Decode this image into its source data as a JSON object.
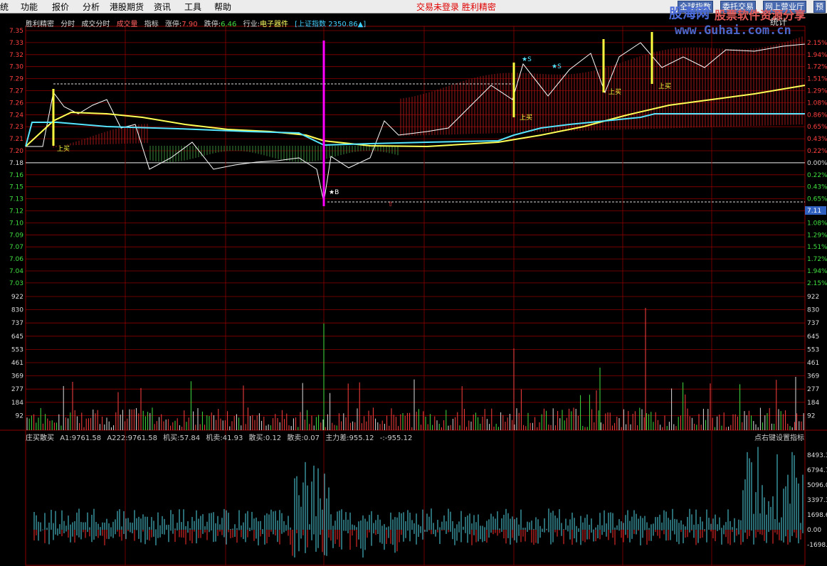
{
  "menu": [
    "统",
    "功能",
    "报价",
    "分析",
    "港股期货",
    "资讯",
    "工具",
    "帮助"
  ],
  "notice": "交易未登录  胜利精密",
  "top_buttons": [
    "全球指数",
    "委托交易",
    "网上营业厅",
    "预"
  ],
  "watermark": {
    "brand": "股海网",
    "slogan": "股票软件资源分享",
    "url": "www.Guhai.com.cn"
  },
  "stat_label": "统计",
  "header": {
    "stock_name": "胜利精密",
    "items": [
      "分时",
      "成交分时",
      "成交量",
      "指标"
    ],
    "limit_up_label": "涨停:",
    "limit_up": "7.90",
    "limit_down_label": "跌停:",
    "limit_down": "6.46",
    "industry_label": "行业:",
    "industry": "电子器件",
    "index_text": "[上证指数 2350.86▲]"
  },
  "price_axis_left": [
    "7.35",
    "7.33",
    "7.32",
    "7.30",
    "7.29",
    "7.27",
    "7.26",
    "7.24",
    "7.23",
    "7.21",
    "7.20",
    "7.18",
    "7.16",
    "7.15",
    "7.13",
    "7.12",
    "7.10",
    "7.09",
    "7.07",
    "7.06",
    "7.04",
    "7.03"
  ],
  "pct_axis_right": [
    "2.15%",
    "1.94%",
    "1.72%",
    "1.51%",
    "1.29%",
    "1.08%",
    "0.86%",
    "0.65%",
    "0.43%",
    "0.22%",
    "0.00%",
    "0.22%",
    "0.43%",
    "0.65%",
    "",
    "1.08%",
    "1.29%",
    "1.51%",
    "1.72%",
    "1.94%",
    "2.15%"
  ],
  "cur_price_tag": "7.11",
  "volume_axis": [
    "922",
    "830",
    "737",
    "645",
    "553",
    "461",
    "369",
    "277",
    "184",
    "92"
  ],
  "indicator_header": {
    "name": "庄买散买",
    "items": [
      "A1:9761.58",
      "A222:9761.58",
      "机买:57.84",
      "机卖:41.93",
      "散买:0.12",
      "散卖:0.07",
      "主力差:955.12",
      "-:-955.12"
    ]
  },
  "indicator_setting": "点右键设置指标",
  "indicator_axis": [
    "8493.3",
    "6794.7",
    "5096.0",
    "3397.3",
    "1698.6",
    "0.00",
    "-1698.6"
  ],
  "markers": [
    {
      "glyph": "上",
      "text": "买"
    },
    {
      "glyph": "★",
      "text": "B"
    },
    {
      "glyph": "★",
      "text": "S"
    },
    {
      "glyph": "上",
      "text": "买"
    }
  ],
  "colors": {
    "grid": "#8b0000",
    "price_line": "#ffffff",
    "avg_line": "#ffff55",
    "ma_line": "#55e5ff",
    "up": "#ff3030",
    "down": "#00c000",
    "accent": "#ff00ff"
  }
}
